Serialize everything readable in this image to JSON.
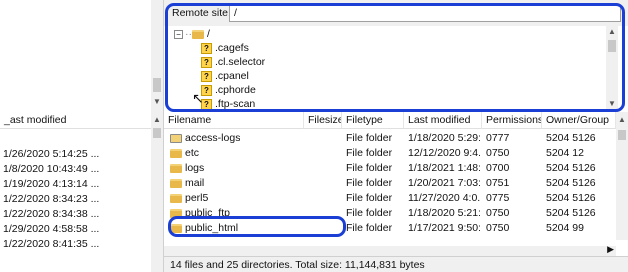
{
  "remote": {
    "label": "Remote site:",
    "path": "/"
  },
  "tree": {
    "root": "/",
    "children": [
      ".cagefs",
      ".cl.selector",
      ".cpanel",
      ".cphorde",
      ".ftp-scan"
    ]
  },
  "left_list": {
    "header": "_ast modified",
    "rows": [
      "1/26/2020 5:14:25 ...",
      "1/8/2020 10:43:49 ...",
      "1/19/2020 4:13:14 ...",
      "1/22/2020 8:34:23 ...",
      "1/22/2020 8:34:38 ...",
      "1/29/2020 4:58:58 ...",
      "1/22/2020 8:41:35 ..."
    ]
  },
  "files": {
    "columns": [
      "Filename",
      "Filesize",
      "Filetype",
      "Last modified",
      "Permissions",
      "Owner/Group"
    ],
    "rows": [
      {
        "name": "access-logs",
        "type": "File folder",
        "modified": "1/18/2020 5:29:...",
        "perms": "0777",
        "owner": "5204 5126",
        "icon": "shortcut-folder-icon"
      },
      {
        "name": "etc",
        "type": "File folder",
        "modified": "12/12/2020 9:4...",
        "perms": "0750",
        "owner": "5204 12",
        "icon": "folder-icon"
      },
      {
        "name": "logs",
        "type": "File folder",
        "modified": "1/18/2021 1:48:...",
        "perms": "0700",
        "owner": "5204 5126",
        "icon": "folder-icon"
      },
      {
        "name": "mail",
        "type": "File folder",
        "modified": "1/20/2021 7:03:...",
        "perms": "0751",
        "owner": "5204 5126",
        "icon": "folder-icon"
      },
      {
        "name": "perl5",
        "type": "File folder",
        "modified": "11/27/2020 4:0...",
        "perms": "0775",
        "owner": "5204 5126",
        "icon": "folder-icon"
      },
      {
        "name": "public_ftp",
        "type": "File folder",
        "modified": "1/18/2020 5:21:...",
        "perms": "0750",
        "owner": "5204 5126",
        "icon": "folder-icon"
      },
      {
        "name": "public_html",
        "type": "File folder",
        "modified": "1/17/2021 9:50:...",
        "perms": "0750",
        "owner": "5204 99",
        "icon": "folder-icon"
      }
    ],
    "status": "14 files and 25 directories. Total size: 11,144,831 bytes"
  },
  "colors": {
    "highlight": "#1b3fd4",
    "folder": "#e8b94a"
  }
}
